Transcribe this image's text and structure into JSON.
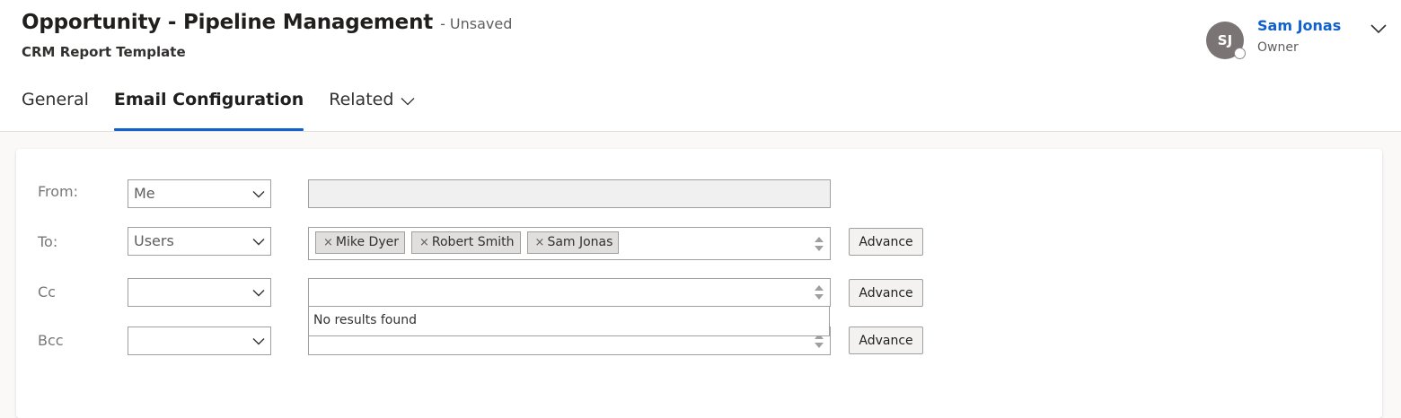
{
  "header": {
    "title": "Opportunity - Pipeline Management",
    "status": "- Unsaved",
    "subtitle": "CRM Report Template"
  },
  "owner": {
    "initials": "SJ",
    "name": "Sam Jonas",
    "role": "Owner"
  },
  "tabs": [
    {
      "label": "General",
      "active": false
    },
    {
      "label": "Email Configuration",
      "active": true
    },
    {
      "label": "Related",
      "active": false
    }
  ],
  "form": {
    "from": {
      "label": "From:",
      "type": "Me",
      "value": ""
    },
    "to": {
      "label": "To:",
      "type": "Users",
      "recipients": [
        "Mike Dyer",
        "Robert Smith",
        "Sam Jonas"
      ]
    },
    "cc": {
      "label": "Cc",
      "type": "",
      "recipients": []
    },
    "bcc": {
      "label": "Bcc",
      "type": "",
      "recipients": []
    },
    "advance_label": "Advance",
    "dropdown_message": "No results found"
  },
  "colors": {
    "accent": "#1160d0",
    "avatar_bg": "#7a7574"
  }
}
